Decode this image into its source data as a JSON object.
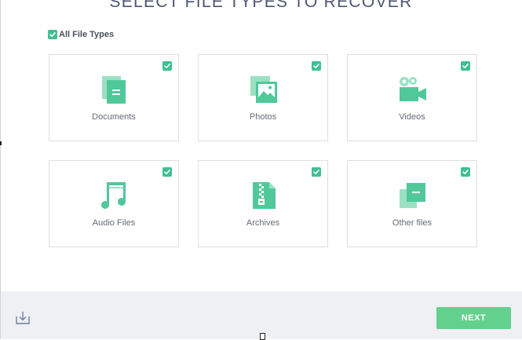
{
  "page": {
    "title": "SELECT FILE TYPES TO RECOVER"
  },
  "all_types": {
    "label": "All File Types",
    "checked": true
  },
  "cards": [
    {
      "label": "Documents",
      "icon": "document-icon",
      "checked": true
    },
    {
      "label": "Photos",
      "icon": "photo-icon",
      "checked": true
    },
    {
      "label": "Videos",
      "icon": "video-camera-icon",
      "checked": true
    },
    {
      "label": "Audio Files",
      "icon": "music-note-icon",
      "checked": true
    },
    {
      "label": "Archives",
      "icon": "archive-icon",
      "checked": true
    },
    {
      "label": "Other files",
      "icon": "other-files-icon",
      "checked": true
    }
  ],
  "footer": {
    "download_icon": "download-icon",
    "next_label": "NEXT"
  },
  "colors": {
    "accent": "#3fbf93",
    "icon": "#50c89a",
    "next_button": "#64d08d",
    "title": "#4a5670",
    "footer_bg": "#eef0f4"
  }
}
